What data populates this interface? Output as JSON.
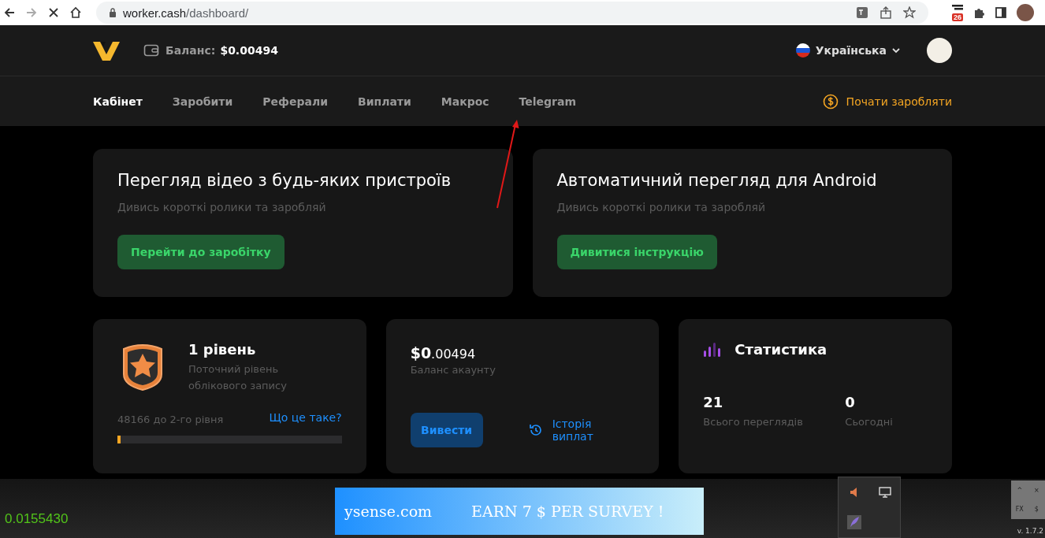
{
  "browser": {
    "url_host": "worker.cash",
    "url_path": "/dashboard/",
    "extension_badge": "26"
  },
  "header": {
    "balance_label": "Баланс:",
    "balance_value": "$0.00494",
    "language": "Українська"
  },
  "nav": {
    "tabs": [
      {
        "label": "Кабінет",
        "selected": true
      },
      {
        "label": "Заробити",
        "selected": false
      },
      {
        "label": "Реферали",
        "selected": false
      },
      {
        "label": "Виплати",
        "selected": false
      },
      {
        "label": "Макрос",
        "selected": false
      },
      {
        "label": "Telegram",
        "selected": false
      }
    ],
    "cta": "Почати заробляти"
  },
  "promo_cards": [
    {
      "title": "Перегляд відео з будь-яких пристроїв",
      "subtitle": "Дивись короткі ролики та заробляй",
      "button": "Перейти до заробітку"
    },
    {
      "title": "Автоматичний перегляд для Android",
      "subtitle": "Дивись короткі ролики та заробляй",
      "button": "Дивитися інструкцію"
    }
  ],
  "level_card": {
    "title": "1 рівень",
    "subtitle": "Поточний рівень облікового запису",
    "progress_text": "48166 до 2-го рівня",
    "link": "Що це таке?",
    "level": 0.015
  },
  "balance_card": {
    "amount_main": "$0",
    "amount_fraction": ".00494",
    "label": "Баланс акаунту",
    "withdraw_button": "Вивести",
    "history_link": "Історія виплат"
  },
  "stats_card": {
    "title": "Статистика",
    "stats": [
      {
        "value": "21",
        "label": "Всього переглядів"
      },
      {
        "value": "0",
        "label": "Сьогодні"
      }
    ]
  },
  "taskbar": {
    "ticker": "0.0155430",
    "ad_site": "ysense.com",
    "ad_text": "EARN 7 $ PER SURVEY !",
    "widget_keys": [
      "^",
      "×",
      "FX",
      "$"
    ],
    "version": "v. 1.7.2"
  }
}
